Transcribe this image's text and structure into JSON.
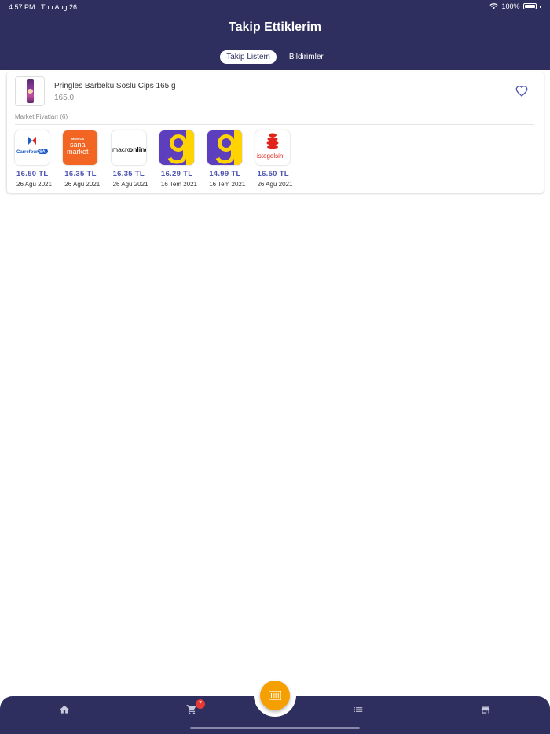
{
  "status": {
    "time": "4:57 PM",
    "date": "Thu Aug 26",
    "battery": "100%"
  },
  "header": {
    "title": "Takip Ettiklerim"
  },
  "tabs": [
    {
      "label": "Takip Listem",
      "active": true
    },
    {
      "label": "Bildirimler",
      "active": false
    }
  ],
  "product": {
    "name": "Pringles Barbekü Soslu Cips 165 g",
    "value": "165.0",
    "favorite": true
  },
  "prices_section": {
    "label": "Market Fiyatları (6)"
  },
  "markets": [
    {
      "logo": "carrefoursa-logo",
      "price": "16.50 TL",
      "date": "26 Ağu 2021"
    },
    {
      "logo": "migros-sanal-market-logo",
      "price": "16.35 TL",
      "date": "26 Ağu 2021"
    },
    {
      "logo": "macro-online-logo",
      "price": "16.35 TL",
      "date": "26 Ağu 2021"
    },
    {
      "logo": "getir-logo",
      "price": "16.29 TL",
      "date": "16 Tem 2021"
    },
    {
      "logo": "getir-logo",
      "price": "14.99 TL",
      "date": "16 Tem 2021"
    },
    {
      "logo": "istegelsin-logo",
      "price": "16.50 TL",
      "date": "26 Ağu 2021"
    }
  ],
  "logo_texts": {
    "carrefour": "Carrefour",
    "sa": "SA",
    "migros": "MIGROS",
    "sanal": "sanal",
    "market": "market",
    "macro": "macro",
    "online": "online",
    "istegelsin": "istegelsin"
  },
  "bottom_nav": {
    "items": [
      "home-icon",
      "cart-icon",
      "list-icon",
      "store-icon"
    ],
    "cart_badge": "7",
    "fab_icon": "barcode-icon"
  },
  "colors": {
    "primary": "#2e2f5f",
    "accent": "#f5a000",
    "price": "#4c55b0",
    "badge": "#e53935"
  }
}
